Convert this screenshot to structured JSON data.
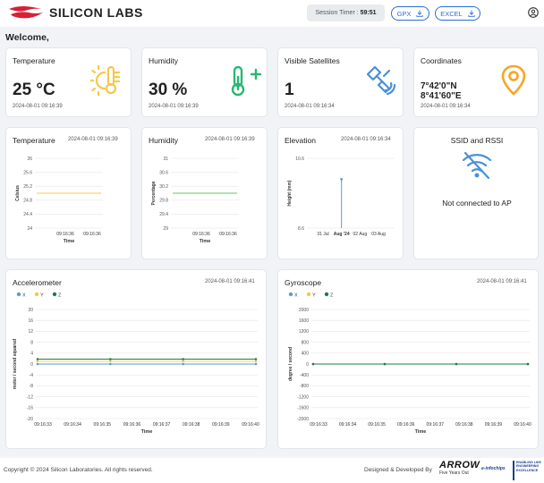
{
  "header": {
    "logo_text": "SILICON LABS",
    "session_label": "Session Timer :",
    "session_value": "59:51",
    "gpx_label": "GPX",
    "excel_label": "EXCEL"
  },
  "welcome": "Welcome,",
  "cards": {
    "temperature": {
      "title": "Temperature",
      "value": "25 °C",
      "timestamp": "2024-08-01 09:16:39"
    },
    "humidity": {
      "title": "Humidity",
      "value": "30 %",
      "timestamp": "2024-08-01 09:16:39"
    },
    "satellites": {
      "title": "Visible Satellites",
      "value": "1",
      "timestamp": "2024-08-01 09:16:34"
    },
    "coordinates": {
      "title": "Coordinates",
      "lat": "7°42'0\"N",
      "lon": "8°41'60\"E",
      "timestamp": "2024-08-01 09:16:34"
    }
  },
  "ssid": {
    "title": "SSID and RSSI",
    "status": "Not connected to AP"
  },
  "colors": {
    "accent": "#2a6ed6",
    "temp_line": "#f5c84a",
    "humidity_line": "#5bc85b",
    "elevation_line": "#5b9bd5",
    "x": "#5b9bd5",
    "y": "#f5c84a",
    "z": "#1f7a4d"
  },
  "icons": [
    "sun-thermometer-icon",
    "thermometer-plus-icon",
    "satellite-icon",
    "location-pin-icon",
    "wifi-off-icon",
    "download-icon",
    "account-icon"
  ],
  "chart_data": [
    {
      "id": "temperature",
      "type": "line",
      "title": "Temperature",
      "timestamp": "2024-08-01 09:16:39",
      "ylabel": "Celsius",
      "xlabel": "Time",
      "yticks": [
        "24",
        "24.4",
        "24.8",
        "25.2",
        "25.6",
        "26"
      ],
      "ylim": [
        24,
        26
      ],
      "xticks": [
        "09:16:36",
        "09:16:36"
      ],
      "series": [
        {
          "values": [
            25,
            25
          ]
        }
      ]
    },
    {
      "id": "humidity",
      "type": "line",
      "title": "Humidity",
      "timestamp": "2024-08-01 09:16:39",
      "ylabel": "Percentage",
      "xlabel": "Time",
      "yticks": [
        "29",
        "29.4",
        "29.8",
        "30.2",
        "30.6",
        "31"
      ],
      "ylim": [
        29,
        31
      ],
      "xticks": [
        "09:16:36",
        "09:16:36"
      ],
      "series": [
        {
          "values": [
            30,
            30
          ]
        }
      ]
    },
    {
      "id": "elevation",
      "type": "line",
      "title": "Elevation",
      "timestamp": "2024-08-01 09:16:34",
      "ylabel": "Height (mm)",
      "xlabel": "",
      "yticks": [
        "8.6",
        "10.6"
      ],
      "ylim": [
        8.6,
        10.6
      ],
      "xticks": [
        "31 Jul",
        "Aug '24",
        "02 Aug",
        "03 Aug"
      ],
      "series": [
        {
          "values": [
            8.6,
            10
          ]
        }
      ]
    },
    {
      "id": "accelerometer",
      "type": "line",
      "title": "Accelerometer",
      "timestamp": "2024-08-01 09:16:41",
      "legend": [
        "X",
        "Y",
        "Z"
      ],
      "ylabel": "meter / second squared",
      "xlabel": "Time",
      "yticks": [
        "20",
        "16",
        "12",
        "8",
        "4",
        "0",
        "-4",
        "-8",
        "-12",
        "-16",
        "-20"
      ],
      "ylim": [
        -20,
        20
      ],
      "xticks": [
        "09:16:33",
        "09:16:34",
        "09:16:35",
        "09:16:36",
        "09:16:37",
        "09:16:38",
        "09:16:39",
        "09:16:40"
      ],
      "series": [
        {
          "name": "X",
          "values": [
            0,
            0,
            0,
            0
          ]
        },
        {
          "name": "Y",
          "values": [
            1,
            1,
            1,
            1
          ]
        },
        {
          "name": "Z",
          "values": [
            1.8,
            1.8,
            1.8,
            1.8
          ]
        }
      ]
    },
    {
      "id": "gyroscope",
      "type": "line",
      "title": "Gyroscope",
      "timestamp": "2024-08-01 09:16:41",
      "legend": [
        "X",
        "Y",
        "Z"
      ],
      "ylabel": "degree / second",
      "xlabel": "Time",
      "yticks": [
        "2000",
        "1600",
        "1200",
        "800",
        "400",
        "0",
        "-400",
        "-800",
        "-1200",
        "-1600",
        "-2000"
      ],
      "ylim": [
        -2000,
        2000
      ],
      "xticks": [
        "09:16:33",
        "09:16:34",
        "09:16:35",
        "09:16:36",
        "09:16:37",
        "09:16:38",
        "09:16:39",
        "09:16:40"
      ],
      "series": [
        {
          "name": "X",
          "values": [
            0,
            0,
            0,
            0
          ]
        },
        {
          "name": "Y",
          "values": [
            0,
            0,
            0,
            0
          ]
        },
        {
          "name": "Z",
          "values": [
            0,
            0,
            0,
            0
          ]
        }
      ]
    }
  ],
  "footer": {
    "copyright": "Copyright © 2024 Silicon Laboratories. All rights reserved.",
    "designed": "Designed & Developed By",
    "arrow": "ARROW",
    "arrow_sub": "Five Years Out",
    "partner1": "e-infochips",
    "partner2": "ENABLING LIKE ENGINEERING EXCELLENCE"
  }
}
